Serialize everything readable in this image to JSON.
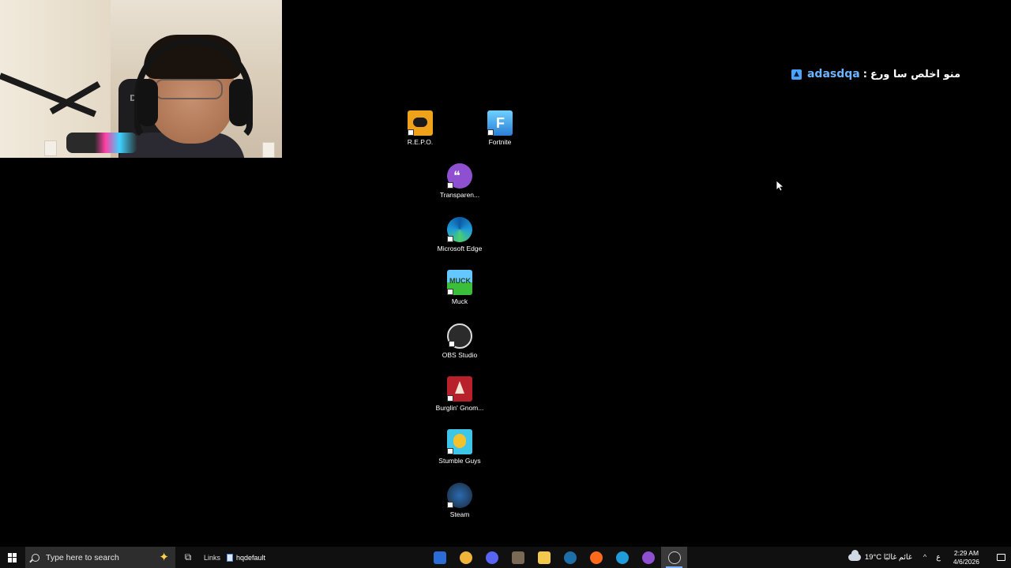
{
  "chat": {
    "username": "adasdqa",
    "separator": ":",
    "message": "منو اخلص سا ورع"
  },
  "desktop_icons": [
    {
      "label": "R.E.P.O.",
      "icon": "repo-game-icon",
      "color": "#f0a21a"
    },
    {
      "label": "Fortnite",
      "icon": "fortnite-icon",
      "color": "#3fa8f4"
    },
    {
      "label": "Transparen...",
      "icon": "transparent-chat-icon",
      "color": "#8e4fd1"
    },
    {
      "label": "Microsoft Edge",
      "icon": "edge-icon",
      "color": "#1f9cd9"
    },
    {
      "label": "Muck",
      "icon": "muck-icon",
      "color": "#3bbf3b"
    },
    {
      "label": "OBS Studio",
      "icon": "obs-icon",
      "color": "#333333"
    },
    {
      "label": "Burglin' Gnom...",
      "icon": "burglin-gnomes-icon",
      "color": "#b8202b"
    },
    {
      "label": "Stumble Guys",
      "icon": "stumble-guys-icon",
      "color": "#3ec6e8"
    },
    {
      "label": "Steam",
      "icon": "steam-icon",
      "color": "#1b2838"
    }
  ],
  "taskbar": {
    "search_placeholder": "Type here to search",
    "links_label": "Links",
    "file_label": "hqdefault",
    "weather": "19°C  غائم غالبًا",
    "language": "ع",
    "time": "2:29 AM",
    "date": "4/6/2026",
    "apps": [
      {
        "name": "outlook-icon",
        "color": "#2b6cd6"
      },
      {
        "name": "emoji-app-icon",
        "color": "#f0b43a"
      },
      {
        "name": "discord-icon",
        "color": "#5865f2"
      },
      {
        "name": "photo-app-icon",
        "color": "#7a6a55"
      },
      {
        "name": "file-explorer-icon",
        "color": "#f2c94c"
      },
      {
        "name": "steam-icon",
        "color": "#1e6fa8"
      },
      {
        "name": "soundcloud-icon",
        "color": "#ff6a1a"
      },
      {
        "name": "edge-icon",
        "color": "#1f9cd9"
      },
      {
        "name": "transparent-chat-icon",
        "color": "#8e4fd1"
      },
      {
        "name": "obs-icon",
        "color": "#cccccc"
      }
    ]
  }
}
